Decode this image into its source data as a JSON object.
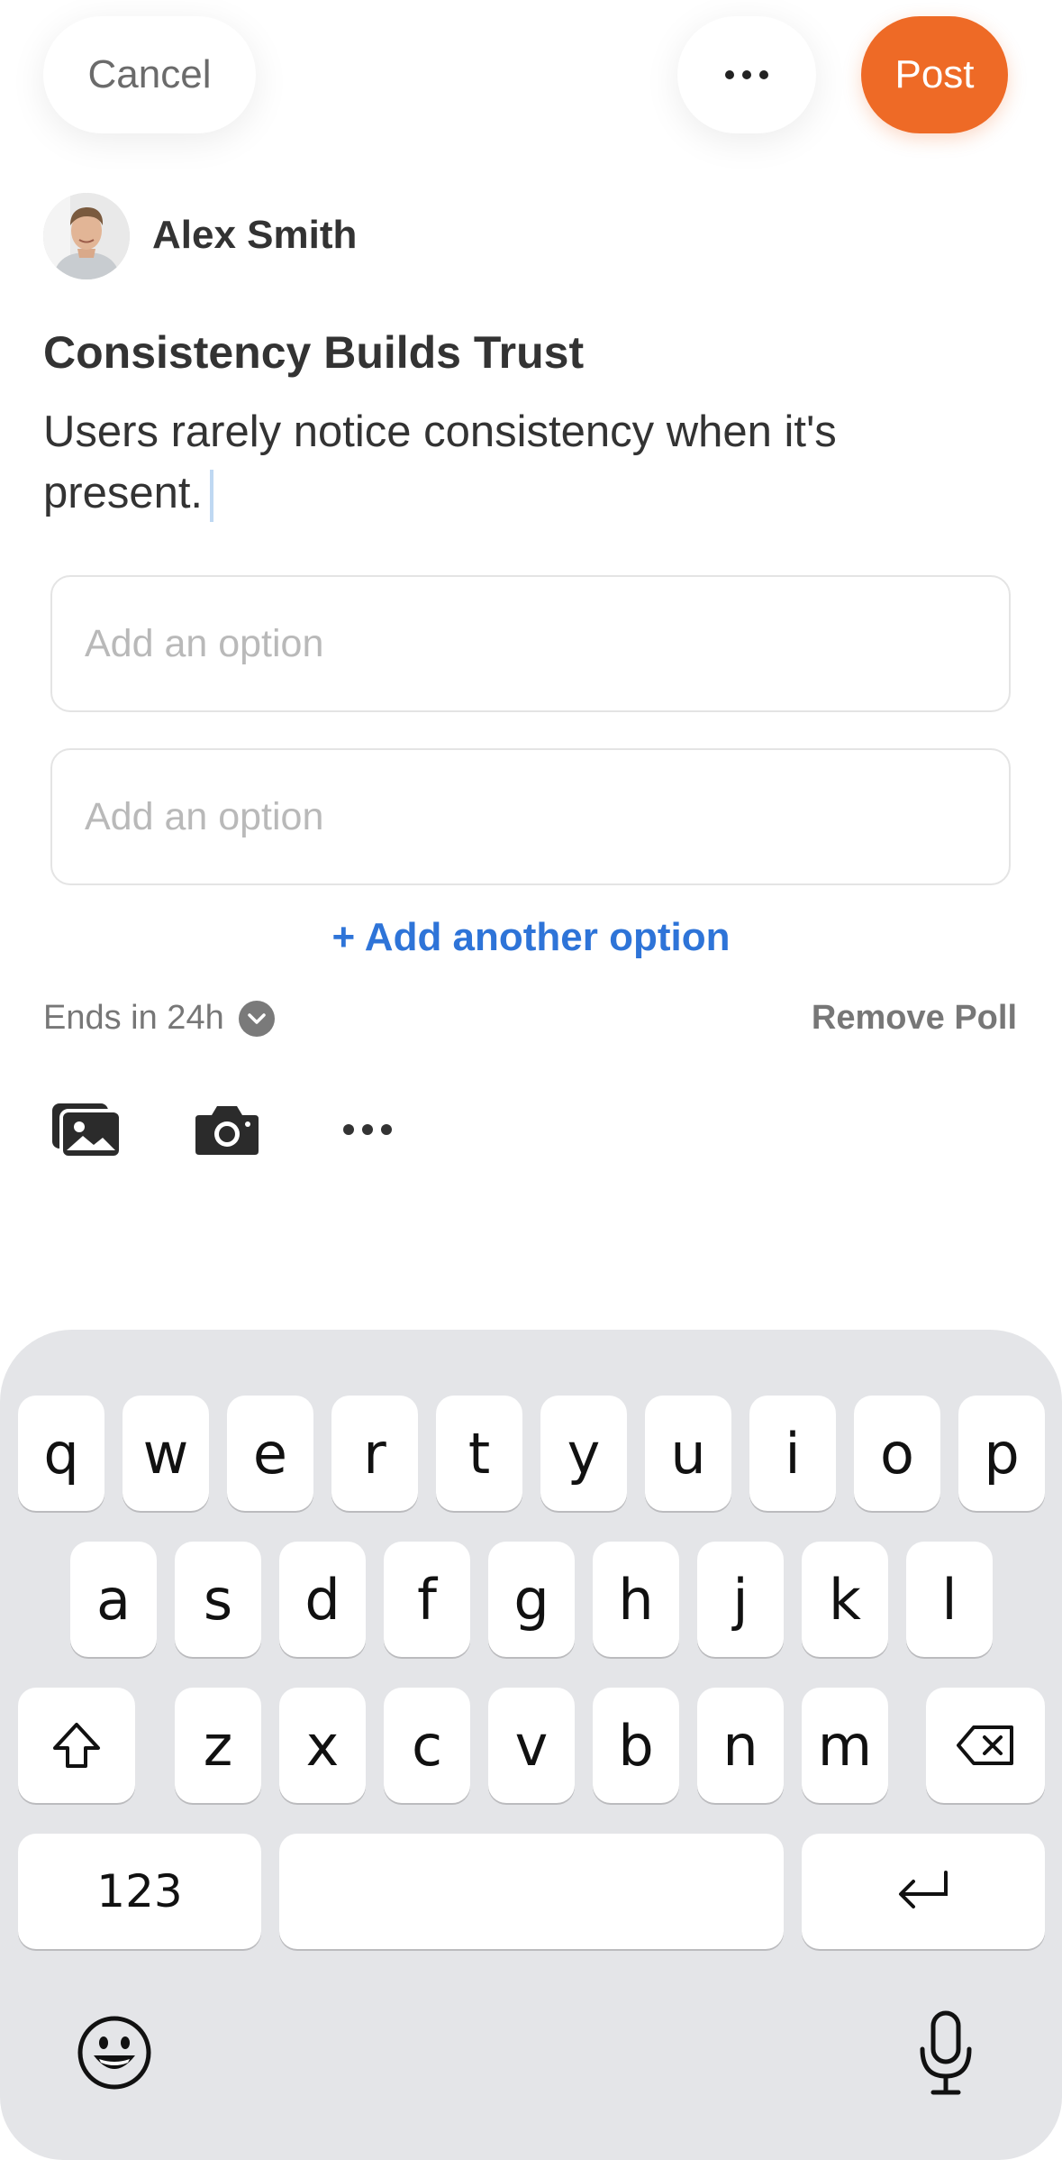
{
  "header": {
    "cancel_label": "Cancel",
    "more_icon": "ellipsis-icon",
    "post_label": "Post",
    "accent_color": "#ee6a26"
  },
  "author": {
    "name": "Alex Smith",
    "avatar_icon": "avatar-photo"
  },
  "post": {
    "title": "Consistency Builds Trust",
    "body": "Users rarely notice consistency when it's present."
  },
  "poll": {
    "options": [
      {
        "value": "",
        "placeholder": "Add an option"
      },
      {
        "value": "",
        "placeholder": "Add an option"
      }
    ],
    "add_option_label": "+ Add another option",
    "add_option_color": "#2e74d8",
    "ends_label": "Ends in 24h",
    "remove_label": "Remove Poll"
  },
  "toolbar": {
    "icons": [
      "gallery-icon",
      "camera-icon",
      "more-icon"
    ]
  },
  "keyboard": {
    "row1": [
      "q",
      "w",
      "e",
      "r",
      "t",
      "y",
      "u",
      "i",
      "o",
      "p"
    ],
    "row2": [
      "a",
      "s",
      "d",
      "f",
      "g",
      "h",
      "j",
      "k",
      "l"
    ],
    "row3": [
      "z",
      "x",
      "c",
      "v",
      "b",
      "n",
      "m"
    ],
    "numbers_label": "123",
    "space_label": "",
    "icons": [
      "shift-icon",
      "backspace-icon",
      "return-icon",
      "emoji-icon",
      "microphone-icon"
    ]
  }
}
